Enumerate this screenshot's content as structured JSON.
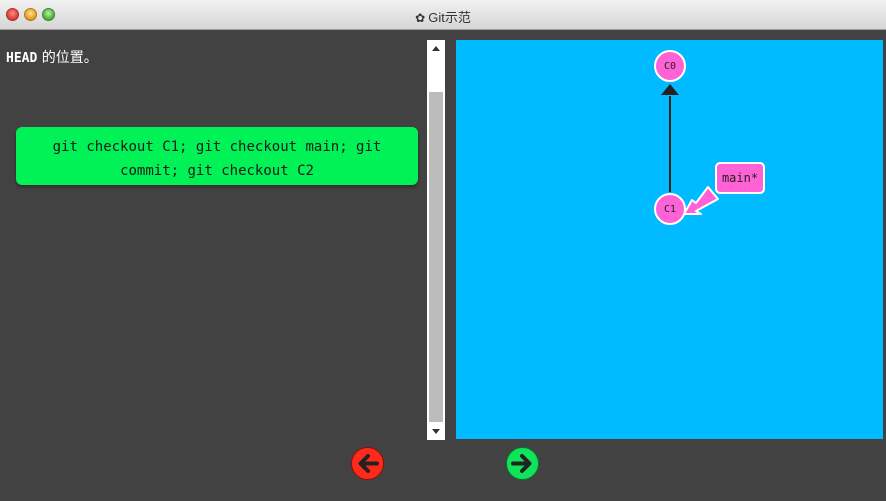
{
  "window": {
    "title": "Git示范",
    "title_icon": "gear-icon"
  },
  "instruction": {
    "head": "HEAD",
    "text": " 的位置。"
  },
  "command": {
    "text": "git checkout C1; git checkout main; git commit; git checkout C2"
  },
  "graph": {
    "commits": [
      {
        "id": "C0",
        "label": "C0"
      },
      {
        "id": "C1",
        "label": "C1",
        "parent": "C0"
      }
    ],
    "branch": {
      "name": "main*",
      "target": "C1"
    },
    "colors": {
      "canvas": "#00bbff",
      "node": "#ff62d6",
      "edge": "#222222"
    }
  },
  "nav": {
    "back_icon": "arrow-left-icon",
    "forward_icon": "arrow-right-icon",
    "back_color": "#ff2a1a",
    "forward_color": "#10e35a"
  }
}
